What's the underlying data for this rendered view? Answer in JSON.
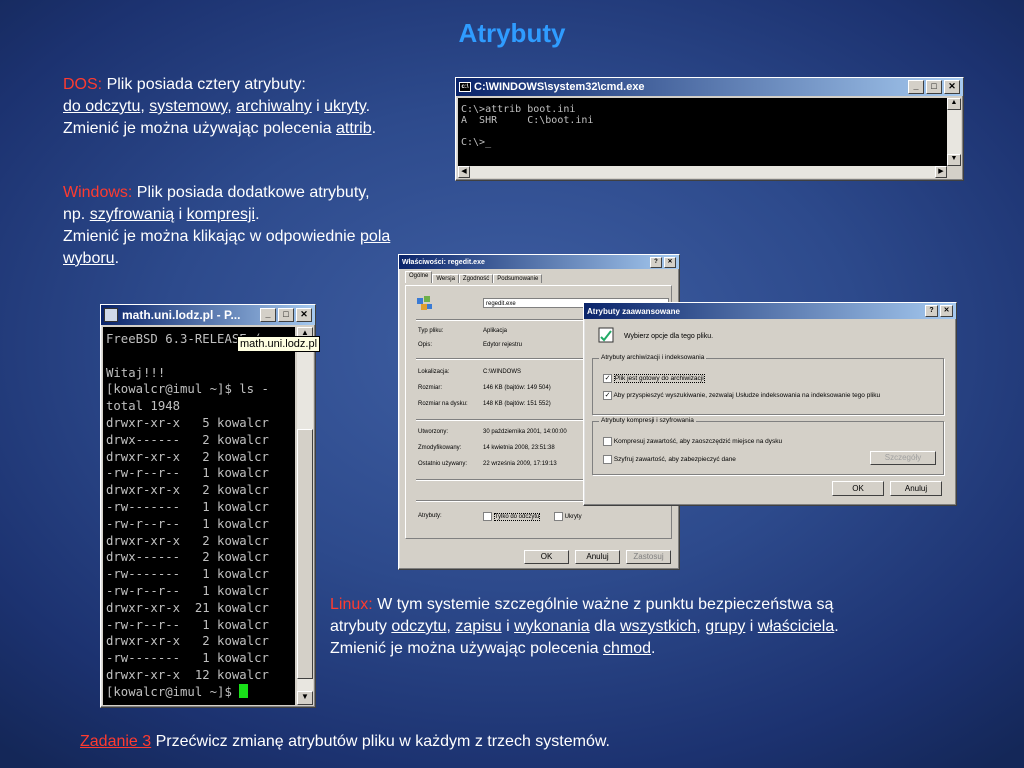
{
  "slide": {
    "title": "Atrybuty",
    "dos": {
      "label": "DOS:",
      "line1": " Plik posiada cztery atrybuty:",
      "attr1": "do odczytu",
      "sep1": ", ",
      "attr2": "systemowy",
      "sep2": ", ",
      "attr3": "archiwalny",
      "sep3": " i ",
      "attr4": "ukryty",
      "end1": ".",
      "line3a": "Zmienić je można używając polecenia ",
      "cmd": "attrib",
      "end2": "."
    },
    "windows": {
      "label": "Windows:",
      "line1": " Plik posiada dodatkowe atrybuty,",
      "line2a": "np. ",
      "attr1": "szyfrowanią",
      "sep": " i ",
      "attr2": "kompresji",
      "end1": ".",
      "line3": "Zmienić je można klikając w odpowiednie ",
      "link1": "pola",
      "link2": "wyboru",
      "end2": "."
    },
    "linux": {
      "label": "Linux:",
      "line1": " W tym systemie szczególnie ważne z punktu bezpieczeństwa są",
      "line2a": "atrybuty ",
      "a1": "odczytu",
      "s1": ", ",
      "a2": "zapisu",
      "s2": " i ",
      "a3": "wykonania",
      "s3": " dla ",
      "a4": "wszystkich",
      "s4": ", ",
      "a5": "grupy",
      "s5": " i ",
      "a6": "właściciela",
      "end1": ".",
      "line3a": "Zmienić je można używając polecenia ",
      "cmd": "chmod",
      "end2": "."
    },
    "task": {
      "label": "Zadanie 3",
      "text": " Przećwicz zmianę atrybutów pliku w każdym z trzech systemów."
    }
  },
  "cmd_window": {
    "title": "C:\\WINDOWS\\system32\\cmd.exe",
    "lines": [
      "C:\\>attrib boot.ini",
      "A  SHR     C:\\boot.ini",
      "",
      "C:\\>_"
    ]
  },
  "putty": {
    "title": "math.uni.lodz.pl - P...",
    "tooltip": "math.uni.lodz.pl",
    "lines": [
      "FreeBSD 6.3-RELEASE (",
      "",
      "Witaj!!!",
      "[kowalcr@imul ~]$ ls -",
      "total 1948",
      "drwxr-xr-x   5 kowalcr",
      "drwx------   2 kowalcr",
      "drwxr-xr-x   2 kowalcr",
      "-rw-r--r--   1 kowalcr",
      "drwxr-xr-x   2 kowalcr",
      "-rw-------   1 kowalcr",
      "-rw-r--r--   1 kowalcr",
      "drwxr-xr-x   2 kowalcr",
      "drwx------   2 kowalcr",
      "-rw-------   1 kowalcr",
      "-rw-r--r--   1 kowalcr",
      "drwxr-xr-x  21 kowalcr",
      "-rw-r--r--   1 kowalcr",
      "drwxr-xr-x   2 kowalcr",
      "-rw-------   1 kowalcr",
      "drwxr-xr-x  12 kowalcr",
      "[kowalcr@imul ~]$ "
    ]
  },
  "props": {
    "title": "Właściwości: regedit.exe",
    "tabs": [
      "Ogólne",
      "Wersja",
      "Zgodność",
      "Podsumowanie"
    ],
    "filename": "regedit.exe",
    "rows": [
      {
        "k": "Typ pliku:",
        "v": "Aplikacja"
      },
      {
        "k": "Opis:",
        "v": "Edytor rejestru"
      },
      {
        "k": "Lokalizacja:",
        "v": "C:\\WINDOWS"
      },
      {
        "k": "Rozmiar:",
        "v": "146 KB (bajtów: 149 504)"
      },
      {
        "k": "Rozmiar na dysku:",
        "v": "148 KB (bajtów: 151 552)"
      },
      {
        "k": "Utworzony:",
        "v": "30 października 2001, 14:00:00"
      },
      {
        "k": "Zmodyfikowany:",
        "v": "14 kwietnia 2008, 23:51:38"
      },
      {
        "k": "Ostatnio używany:",
        "v": "22 września 2009, 17:19:13"
      }
    ],
    "attrs_label": "Atrybuty:",
    "readonly": "Tylko do odczytu",
    "hidden": "Ukryty",
    "ok": "OK",
    "cancel": "Anuluj",
    "apply": "Zastosuj"
  },
  "adv": {
    "title": "Atrybuty zaawansowane",
    "intro": "Wybierz opcje dla tego pliku.",
    "group1": "Atrybuty archiwizacji i indeksowania",
    "opt1": "Plik jest gotowy do archiwizacji",
    "opt2": "Aby przyspieszyć wyszukiwanie, zezwalaj Usłudze indeksowania na indeksowanie tego pliku",
    "group2": "Atrybuty kompresji i szyfrowania",
    "opt3": "Kompresuj zawartość, aby zaoszczędzić miejsce na dysku",
    "opt4": "Szyfruj zawartość, aby zabezpieczyć dane",
    "details": "Szczegóły",
    "ok": "OK",
    "cancel": "Anuluj"
  }
}
